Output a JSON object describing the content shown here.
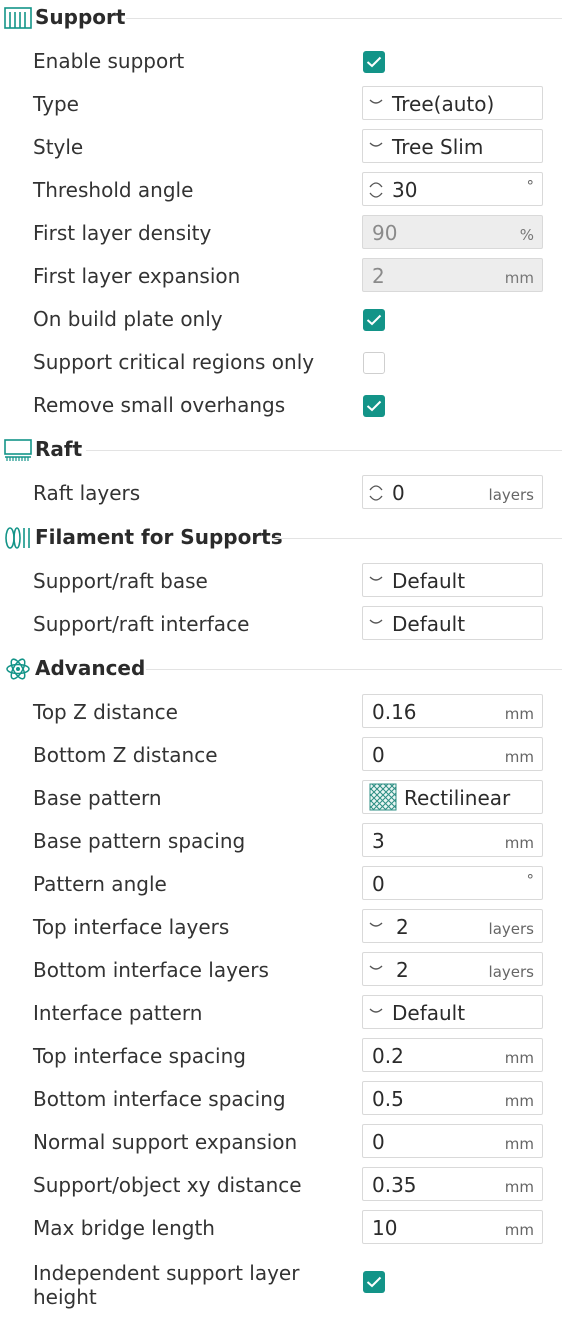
{
  "sections": {
    "support": {
      "title": "Support"
    },
    "raft": {
      "title": "Raft"
    },
    "filament": {
      "title": "Filament for Supports"
    },
    "advanced": {
      "title": "Advanced"
    }
  },
  "settings": {
    "enable_support": {
      "label": "Enable support",
      "checked": true
    },
    "type": {
      "label": "Type",
      "value": "Tree(auto)"
    },
    "style": {
      "label": "Style",
      "value": "Tree Slim"
    },
    "threshold_angle": {
      "label": "Threshold angle",
      "value": "30",
      "unit": "°"
    },
    "first_layer_density": {
      "label": "First layer density",
      "value": "90",
      "unit": "%"
    },
    "first_layer_expansion": {
      "label": "First layer expansion",
      "value": "2",
      "unit": "mm"
    },
    "on_build_plate_only": {
      "label": "On build plate only",
      "checked": true
    },
    "support_critical_regions_only": {
      "label": "Support critical regions only",
      "checked": false
    },
    "remove_small_overhangs": {
      "label": "Remove small overhangs",
      "checked": true
    },
    "raft_layers": {
      "label": "Raft layers",
      "value": "0",
      "unit": "layers"
    },
    "support_raft_base": {
      "label": "Support/raft base",
      "value": "Default"
    },
    "support_raft_interface": {
      "label": "Support/raft interface",
      "value": "Default"
    },
    "top_z_distance": {
      "label": "Top Z distance",
      "value": "0.16",
      "unit": "mm"
    },
    "bottom_z_distance": {
      "label": "Bottom Z distance",
      "value": "0",
      "unit": "mm"
    },
    "base_pattern": {
      "label": "Base pattern",
      "value": "Rectilinear"
    },
    "base_pattern_spacing": {
      "label": "Base pattern spacing",
      "value": "3",
      "unit": "mm"
    },
    "pattern_angle": {
      "label": "Pattern angle",
      "value": "0",
      "unit": "°"
    },
    "top_interface_layers": {
      "label": "Top interface layers",
      "value": "2",
      "unit": "layers"
    },
    "bottom_interface_layers": {
      "label": "Bottom interface layers",
      "value": "2",
      "unit": "layers"
    },
    "interface_pattern": {
      "label": "Interface pattern",
      "value": "Default"
    },
    "top_interface_spacing": {
      "label": "Top interface spacing",
      "value": "0.2",
      "unit": "mm"
    },
    "bottom_interface_spacing": {
      "label": "Bottom interface spacing",
      "value": "0.5",
      "unit": "mm"
    },
    "normal_support_expansion": {
      "label": "Normal support expansion",
      "value": "0",
      "unit": "mm"
    },
    "support_object_xy_distance": {
      "label": "Support/object xy distance",
      "value": "0.35",
      "unit": "mm"
    },
    "max_bridge_length": {
      "label": "Max bridge length",
      "value": "10",
      "unit": "mm"
    },
    "independent_support_layer_height": {
      "label": "Independent support layer height",
      "checked": true
    }
  },
  "colors": {
    "accent": "#139488",
    "disabled_bg": "#ededed",
    "border": "#d9d9d9"
  }
}
